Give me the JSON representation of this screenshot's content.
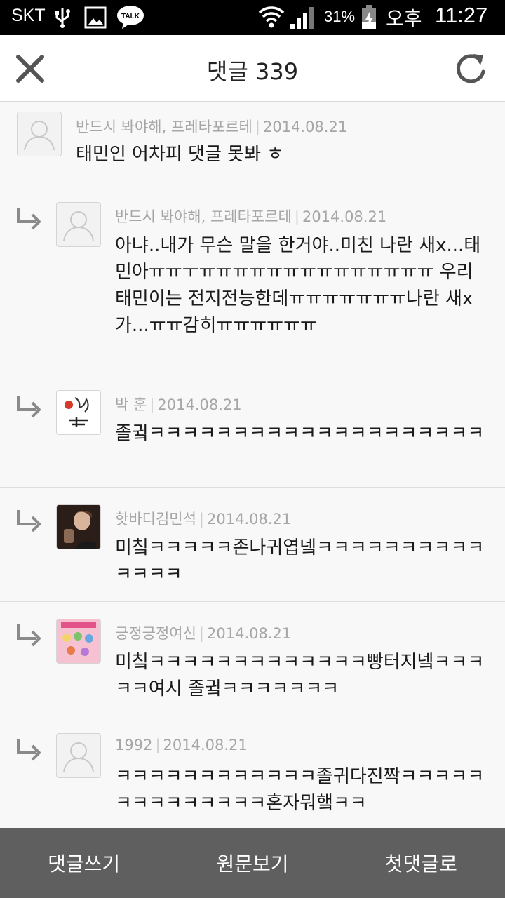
{
  "status_bar": {
    "carrier": "SKT",
    "battery_percent": "31%",
    "ampm": "오후",
    "time": "11:27",
    "icons": [
      "usb-icon",
      "image-icon",
      "talk-icon",
      "wifi-icon",
      "signal-icon",
      "battery-icon"
    ],
    "talk_label": "TALK"
  },
  "header": {
    "title": "댓글 339",
    "close_icon": "close-icon",
    "refresh_icon": "refresh-icon"
  },
  "comments": [
    {
      "is_reply": false,
      "author": "반드시 봐야해, 프레타포르테",
      "date": "2014.08.21",
      "text": "태민인 어차피 댓글 못봐 ㅎ",
      "avatar": "default-avatar"
    },
    {
      "is_reply": true,
      "author": "반드시 봐야해, 프레타포르테",
      "date": "2014.08.21",
      "text": "아냐..내가 무슨 말을 한거야..미친 나란 새x...태민아ㅠㅠㅜㅠㅠㅠㅠㅠㅠㅠㅠㅠㅠㅠㅠㅠㅠ 우리태민이는 전지전능한데ㅠㅠㅠㅠㅠㅠㅠ나란 새x가...ㅠㅠ감히ㅠㅠㅠㅠㅠㅠ",
      "avatar": "default-avatar"
    },
    {
      "is_reply": true,
      "author": "박 훈",
      "date": "2014.08.21",
      "text": "졸귘ㅋㅋㅋㅋㅋㅋㅋㅋㅋㅋㅋㅋㅋㅋㅋㅋㅋㅋㅋㅋ",
      "avatar": "drawing-avatar"
    },
    {
      "is_reply": true,
      "author": "핫바디김민석",
      "date": "2014.08.21",
      "text": "미칰ㅋㅋㅋㅋㅋ존나귀엽넼ㅋㅋㅋㅋㅋㅋㅋㅋㅋㅋㅋㅋㅋㅋ",
      "avatar": "photo-avatar"
    },
    {
      "is_reply": true,
      "author": "긍정긍정여신",
      "date": "2014.08.21",
      "text": "미칰ㅋㅋㅋㅋㅋㅋㅋㅋㅋㅋㅋㅋㅋ빵터지넼ㅋㅋㅋㅋㅋ여시 졸귘ㅋㅋㅋㅋㅋㅋㅋ",
      "avatar": "pink-avatar"
    },
    {
      "is_reply": true,
      "author": "1992",
      "date": "2014.08.21",
      "text": "ㅋㅋㅋㅋㅋㅋㅋㅋㅋㅋㅋㅋ졸귀다진짝ㅋㅋㅋㅋㅋㅋㅋㅋㅋㅋㅋㅋㅋㅋ혼자뭐햌ㅋㅋ",
      "avatar": "default-avatar"
    }
  ],
  "bottom_bar": {
    "write_label": "댓글쓰기",
    "original_label": "원문보기",
    "first_label": "첫댓글로"
  },
  "colors": {
    "status_bar_bg": "#000000",
    "header_bg": "#ffffff",
    "list_bg": "#f8f8f8",
    "meta_text": "#a6a6a6",
    "bottom_bar_bg": "#5f5f5f"
  }
}
